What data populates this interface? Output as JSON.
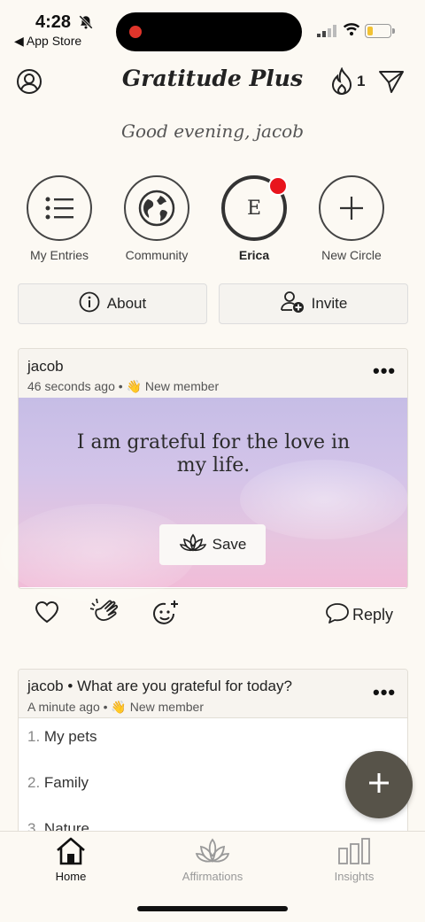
{
  "status_bar": {
    "time": "4:28",
    "back_label": "App Store"
  },
  "header": {
    "title": "Gratitude Plus",
    "streak_count": "1"
  },
  "greeting": "Good evening, jacob",
  "circles": [
    {
      "label": "My Entries",
      "icon": "list-icon"
    },
    {
      "label": "Community",
      "icon": "globe-icon"
    },
    {
      "label": "Erica",
      "initial": "E",
      "icon": "avatar",
      "has_notification": true
    },
    {
      "label": "New Circle",
      "icon": "plus-icon"
    }
  ],
  "actions": {
    "about_label": "About",
    "invite_label": "Invite"
  },
  "post1": {
    "author": "jacob",
    "time": "46 seconds ago",
    "badge_emoji": "👋",
    "badge_text": "New member",
    "quote": "I am grateful for the love in my life.",
    "save_label": "Save",
    "reply_label": "Reply"
  },
  "post2": {
    "author": "jacob",
    "prompt": "What are you grateful for today?",
    "time": "A minute ago",
    "badge_emoji": "👋",
    "badge_text": "New member",
    "items": [
      {
        "num": "1.",
        "text": "My pets"
      },
      {
        "num": "2.",
        "text": "Family"
      },
      {
        "num": "3.",
        "text": "Nature"
      }
    ]
  },
  "tabs": [
    {
      "label": "Home",
      "active": true
    },
    {
      "label": "Affirmations",
      "active": false
    },
    {
      "label": "Insights",
      "active": false
    }
  ],
  "colors": {
    "background": "#fcf9f3",
    "accent_dark": "#575349",
    "notification": "#e8141c",
    "inactive": "#999999"
  }
}
